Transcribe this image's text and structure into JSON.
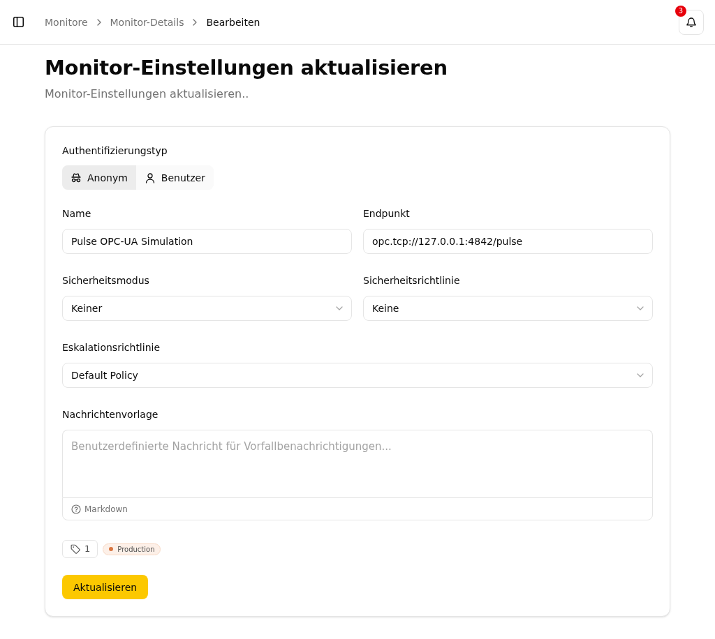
{
  "header": {
    "breadcrumbs": [
      {
        "label": "Monitore",
        "current": false
      },
      {
        "label": "Monitor-Details",
        "current": false
      },
      {
        "label": "Bearbeiten",
        "current": true
      }
    ],
    "notification_count": "3"
  },
  "page": {
    "title": "Monitor-Einstellungen aktualisieren",
    "subtitle": "Monitor-Einstellungen aktualisieren.."
  },
  "form": {
    "auth_type": {
      "label": "Authentifizierungstyp",
      "options": [
        {
          "kind": "anonymous",
          "label": "Anonym",
          "selected": true
        },
        {
          "kind": "user",
          "label": "Benutzer",
          "selected": false
        }
      ]
    },
    "rows": [
      [
        {
          "kind": "input",
          "label": "Name",
          "value": "Pulse OPC-UA Simulation"
        },
        {
          "kind": "input",
          "label": "Endpunkt",
          "value": "opc.tcp://127.0.0.1:4842/pulse"
        }
      ],
      [
        {
          "kind": "select",
          "label": "Sicherheitsmodus",
          "value": "Keiner"
        },
        {
          "kind": "select",
          "label": "Sicherheitsrichtlinie",
          "value": "Keine"
        }
      ],
      [
        {
          "kind": "select",
          "label": "Eskalationsrichtlinie",
          "value": "Default Policy"
        }
      ],
      [
        {
          "kind": "textarea",
          "label": "Nachrichtenvorlage",
          "placeholder": "Benutzerdefinierte Nachricht für Vorfallbenachrichtigungen...",
          "footer": "Markdown"
        }
      ]
    ],
    "tags": {
      "count": "1",
      "items": [
        {
          "label": "Production",
          "color": "#d97742"
        }
      ]
    },
    "submit": "Aktualisieren"
  }
}
